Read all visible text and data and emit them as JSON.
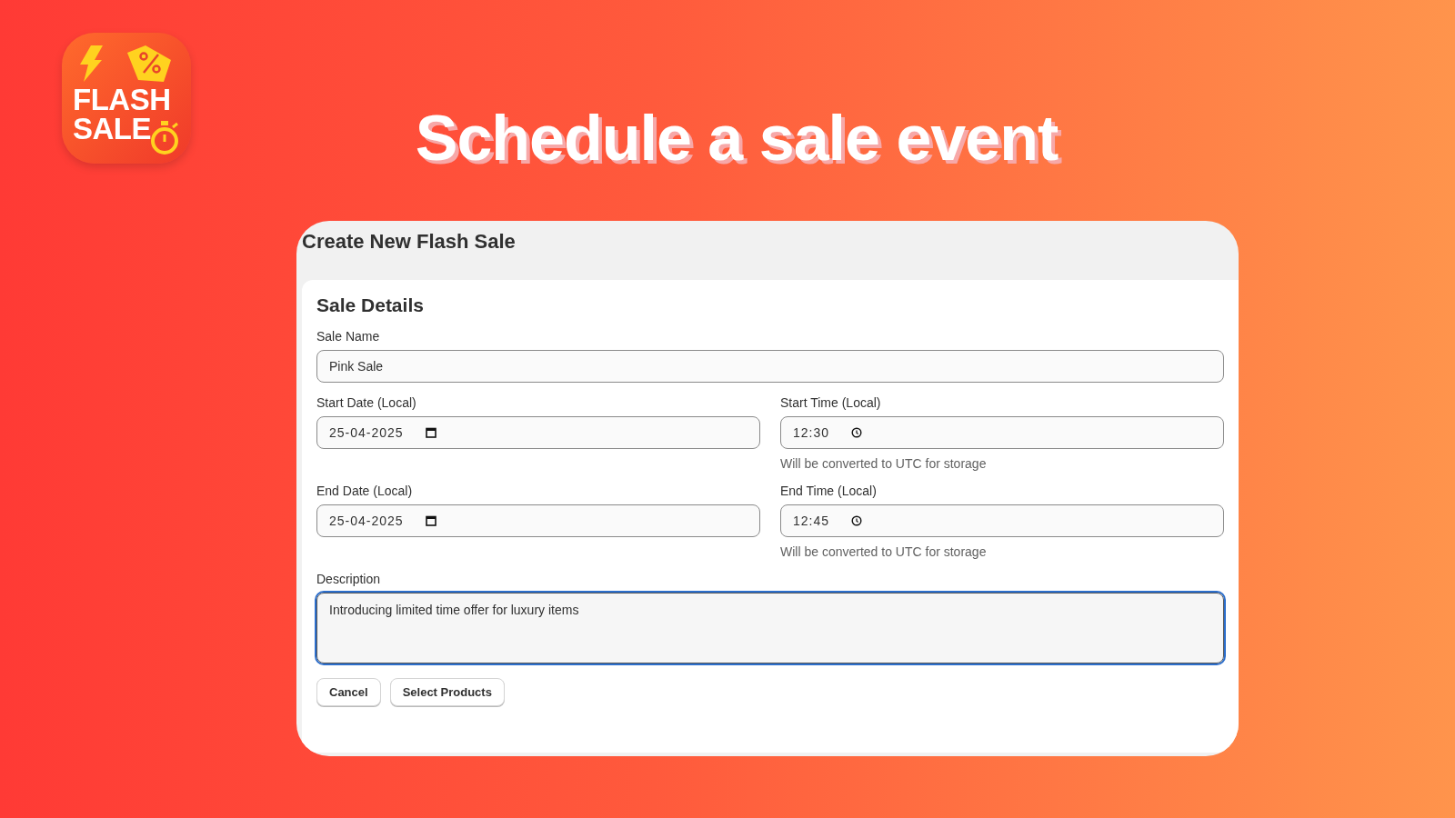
{
  "logo": {
    "line_1": "FLASH",
    "line_2": "SALE"
  },
  "headline": "Schedule a sale event",
  "window": {
    "title": "Create New Flash Sale"
  },
  "section": {
    "title": "Sale Details",
    "fields": [
      {
        "kind": "text",
        "label": "Sale Name",
        "value": "Pink Sale"
      },
      {
        "kind": "date",
        "label": "Start Date (Local)",
        "value": "25-04-2025"
      },
      {
        "kind": "time",
        "label": "Start Time (Local)",
        "value": "12:30",
        "hint": "Will be converted to UTC for storage"
      },
      {
        "kind": "date",
        "label": "End Date (Local)",
        "value": "25-04-2025"
      },
      {
        "kind": "time",
        "label": "End Time (Local)",
        "value": "12:45",
        "hint": "Will be converted to UTC for storage"
      },
      {
        "kind": "textarea",
        "label": "Description",
        "value": "Introducing limited time offer for luxury items",
        "focused": true
      }
    ],
    "buttons": [
      "Cancel",
      "Select Products"
    ]
  }
}
